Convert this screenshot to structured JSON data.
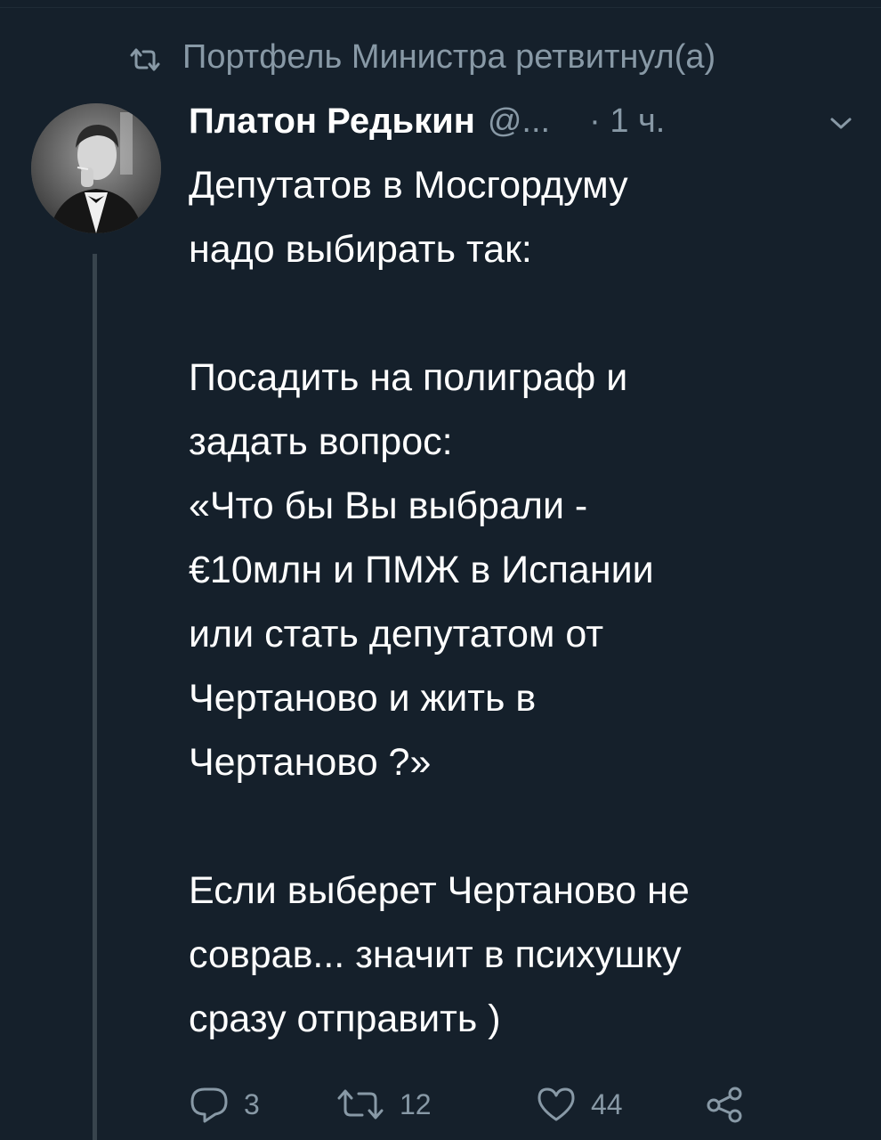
{
  "retweet_context": {
    "text": "Портфель Министра ретвитнул(а)"
  },
  "tweet": {
    "author_name": "Платон Редькин",
    "handle": "@...",
    "time": "· 1 ч.",
    "text": "Депутатов в Мосгордуму\nнадо выбирать так:\n\nПосадить на полиграф и\nзадать вопрос:\n«Что бы Вы выбрали -\n€10млн и ПМЖ в Испании\nили стать депутатом от\nЧертаново и жить в\nЧертаново ?»\n\nЕсли выберет Чертаново не\nсоврав... значит в психушку\nсразу отправить )"
  },
  "actions": {
    "reply_count": "3",
    "retweet_count": "12",
    "like_count": "44"
  },
  "icons": {
    "retweet_context_icon": "retweet-icon",
    "menu_icon": "chevron-down-icon",
    "reply_icon": "reply-icon",
    "retweet_icon": "retweet-icon",
    "like_icon": "heart-icon",
    "share_icon": "share-icon"
  },
  "colors": {
    "background": "#15202b",
    "text_primary": "#ffffff",
    "text_secondary": "#8899a6",
    "thread_line": "#38444d"
  }
}
